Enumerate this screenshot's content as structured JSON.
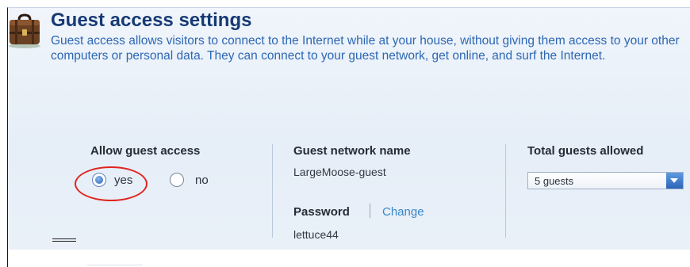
{
  "page": {
    "title": "Guest access settings",
    "description": "Guest access allows visitors to connect to the Internet while at your house, without giving them access to your other computers or personal data. They can connect to your guest network, get online, and surf the Internet."
  },
  "allow_guest_access": {
    "label": "Allow guest access",
    "options": [
      {
        "label": "yes",
        "selected": true
      },
      {
        "label": "no",
        "selected": false
      }
    ],
    "highlight_color": "#e0251f"
  },
  "guest_network_name": {
    "label": "Guest network name",
    "value": "LargeMoose-guest"
  },
  "password": {
    "label": "Password",
    "change_label": "Change",
    "value": "lettuce44"
  },
  "total_guests": {
    "label": "Total guests allowed",
    "selected": "5 guests"
  },
  "icons": {
    "header": "suitcase-icon",
    "dropdown": "chevron-down-icon"
  },
  "colors": {
    "title": "#163a74",
    "description": "#2c67b4",
    "link": "#3a87c9",
    "accent": "#2a64b8"
  }
}
